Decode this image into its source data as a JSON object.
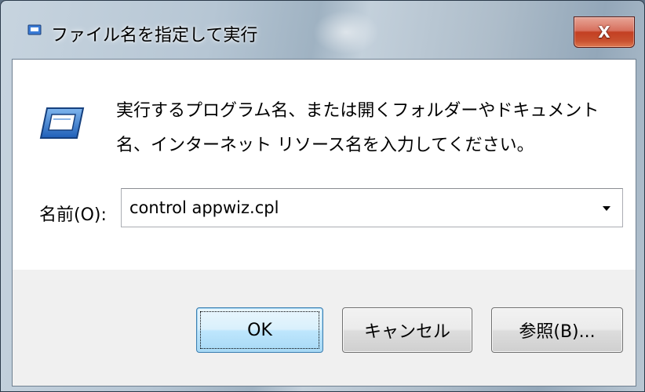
{
  "window": {
    "title": "ファイル名を指定して実行",
    "close_label": "X"
  },
  "dialog": {
    "description": "実行するプログラム名、または開くフォルダーやドキュメント名、インターネット リソース名を入力してください。",
    "name_label": "名前(O):",
    "input_value": "control appwiz.cpl",
    "dropdown_icon": "chevron-down-icon"
  },
  "buttons": {
    "ok": "OK",
    "cancel": "キャンセル",
    "browse": "参照(B)..."
  },
  "colors": {
    "close_button": "#c33f22",
    "default_button_border": "#3c7fb1",
    "client_background": "#f0f0f0"
  }
}
